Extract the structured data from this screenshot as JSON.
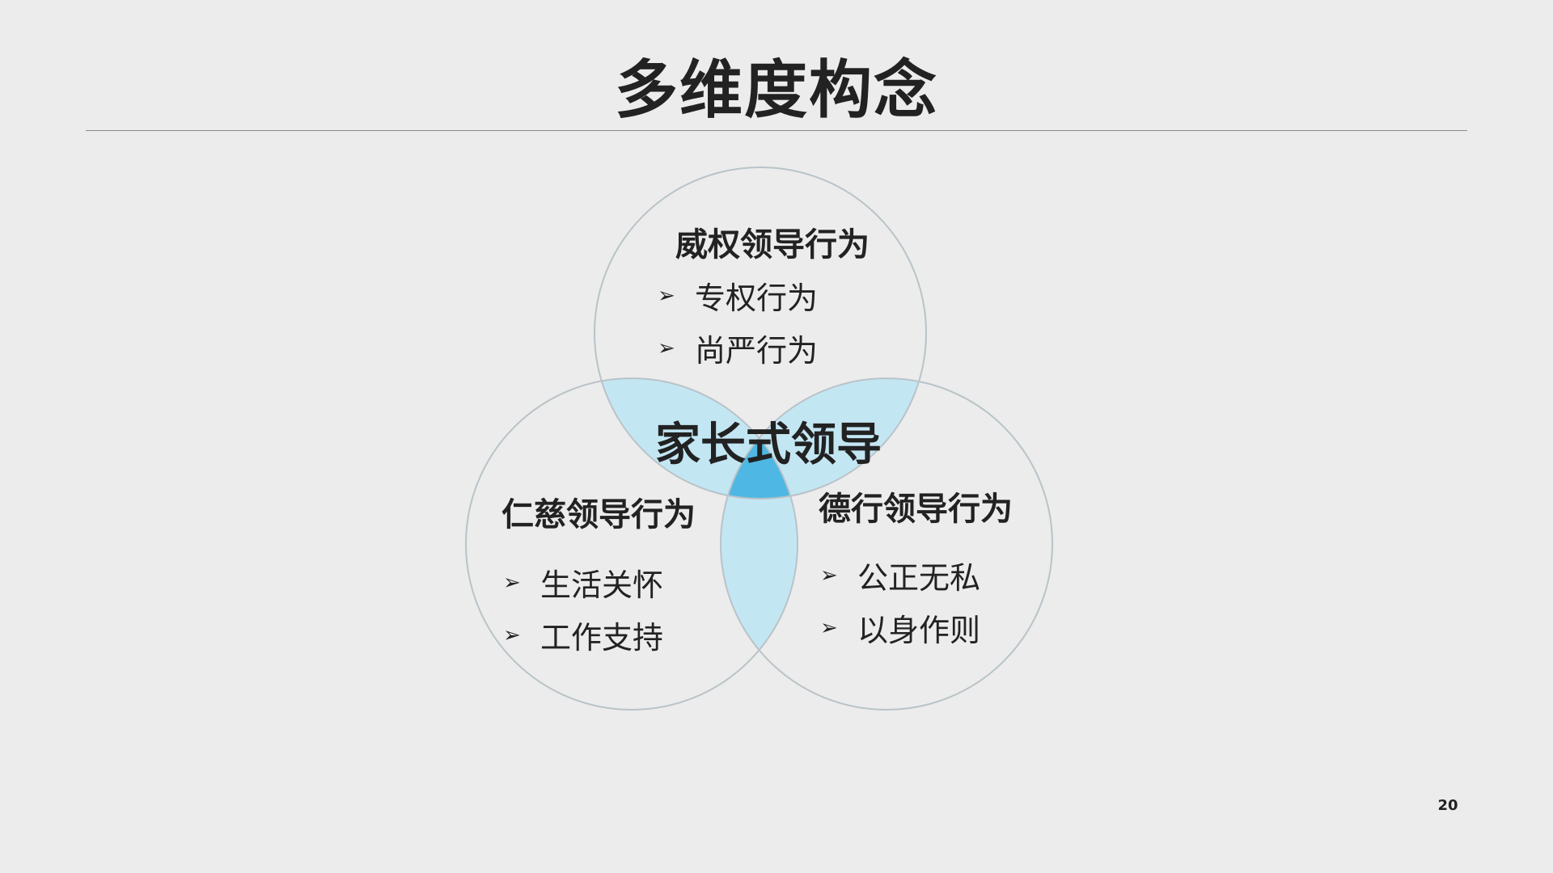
{
  "slide": {
    "title": "多维度构念",
    "page_number": "20"
  },
  "venn": {
    "center": "家长式领导",
    "circles": [
      {
        "heading": "威权领导行为",
        "items": [
          "专权行为",
          "尚严行为"
        ]
      },
      {
        "heading": "仁慈领导行为",
        "items": [
          "生活关怀",
          "工作支持"
        ]
      },
      {
        "heading": "德行领导行为",
        "items": [
          "公正无私",
          "以身作则"
        ]
      }
    ],
    "colors": {
      "overlap_pair": "#c3e6f3",
      "overlap_center": "#4fb7e3",
      "circle_stroke": "#b9c3c8"
    }
  }
}
